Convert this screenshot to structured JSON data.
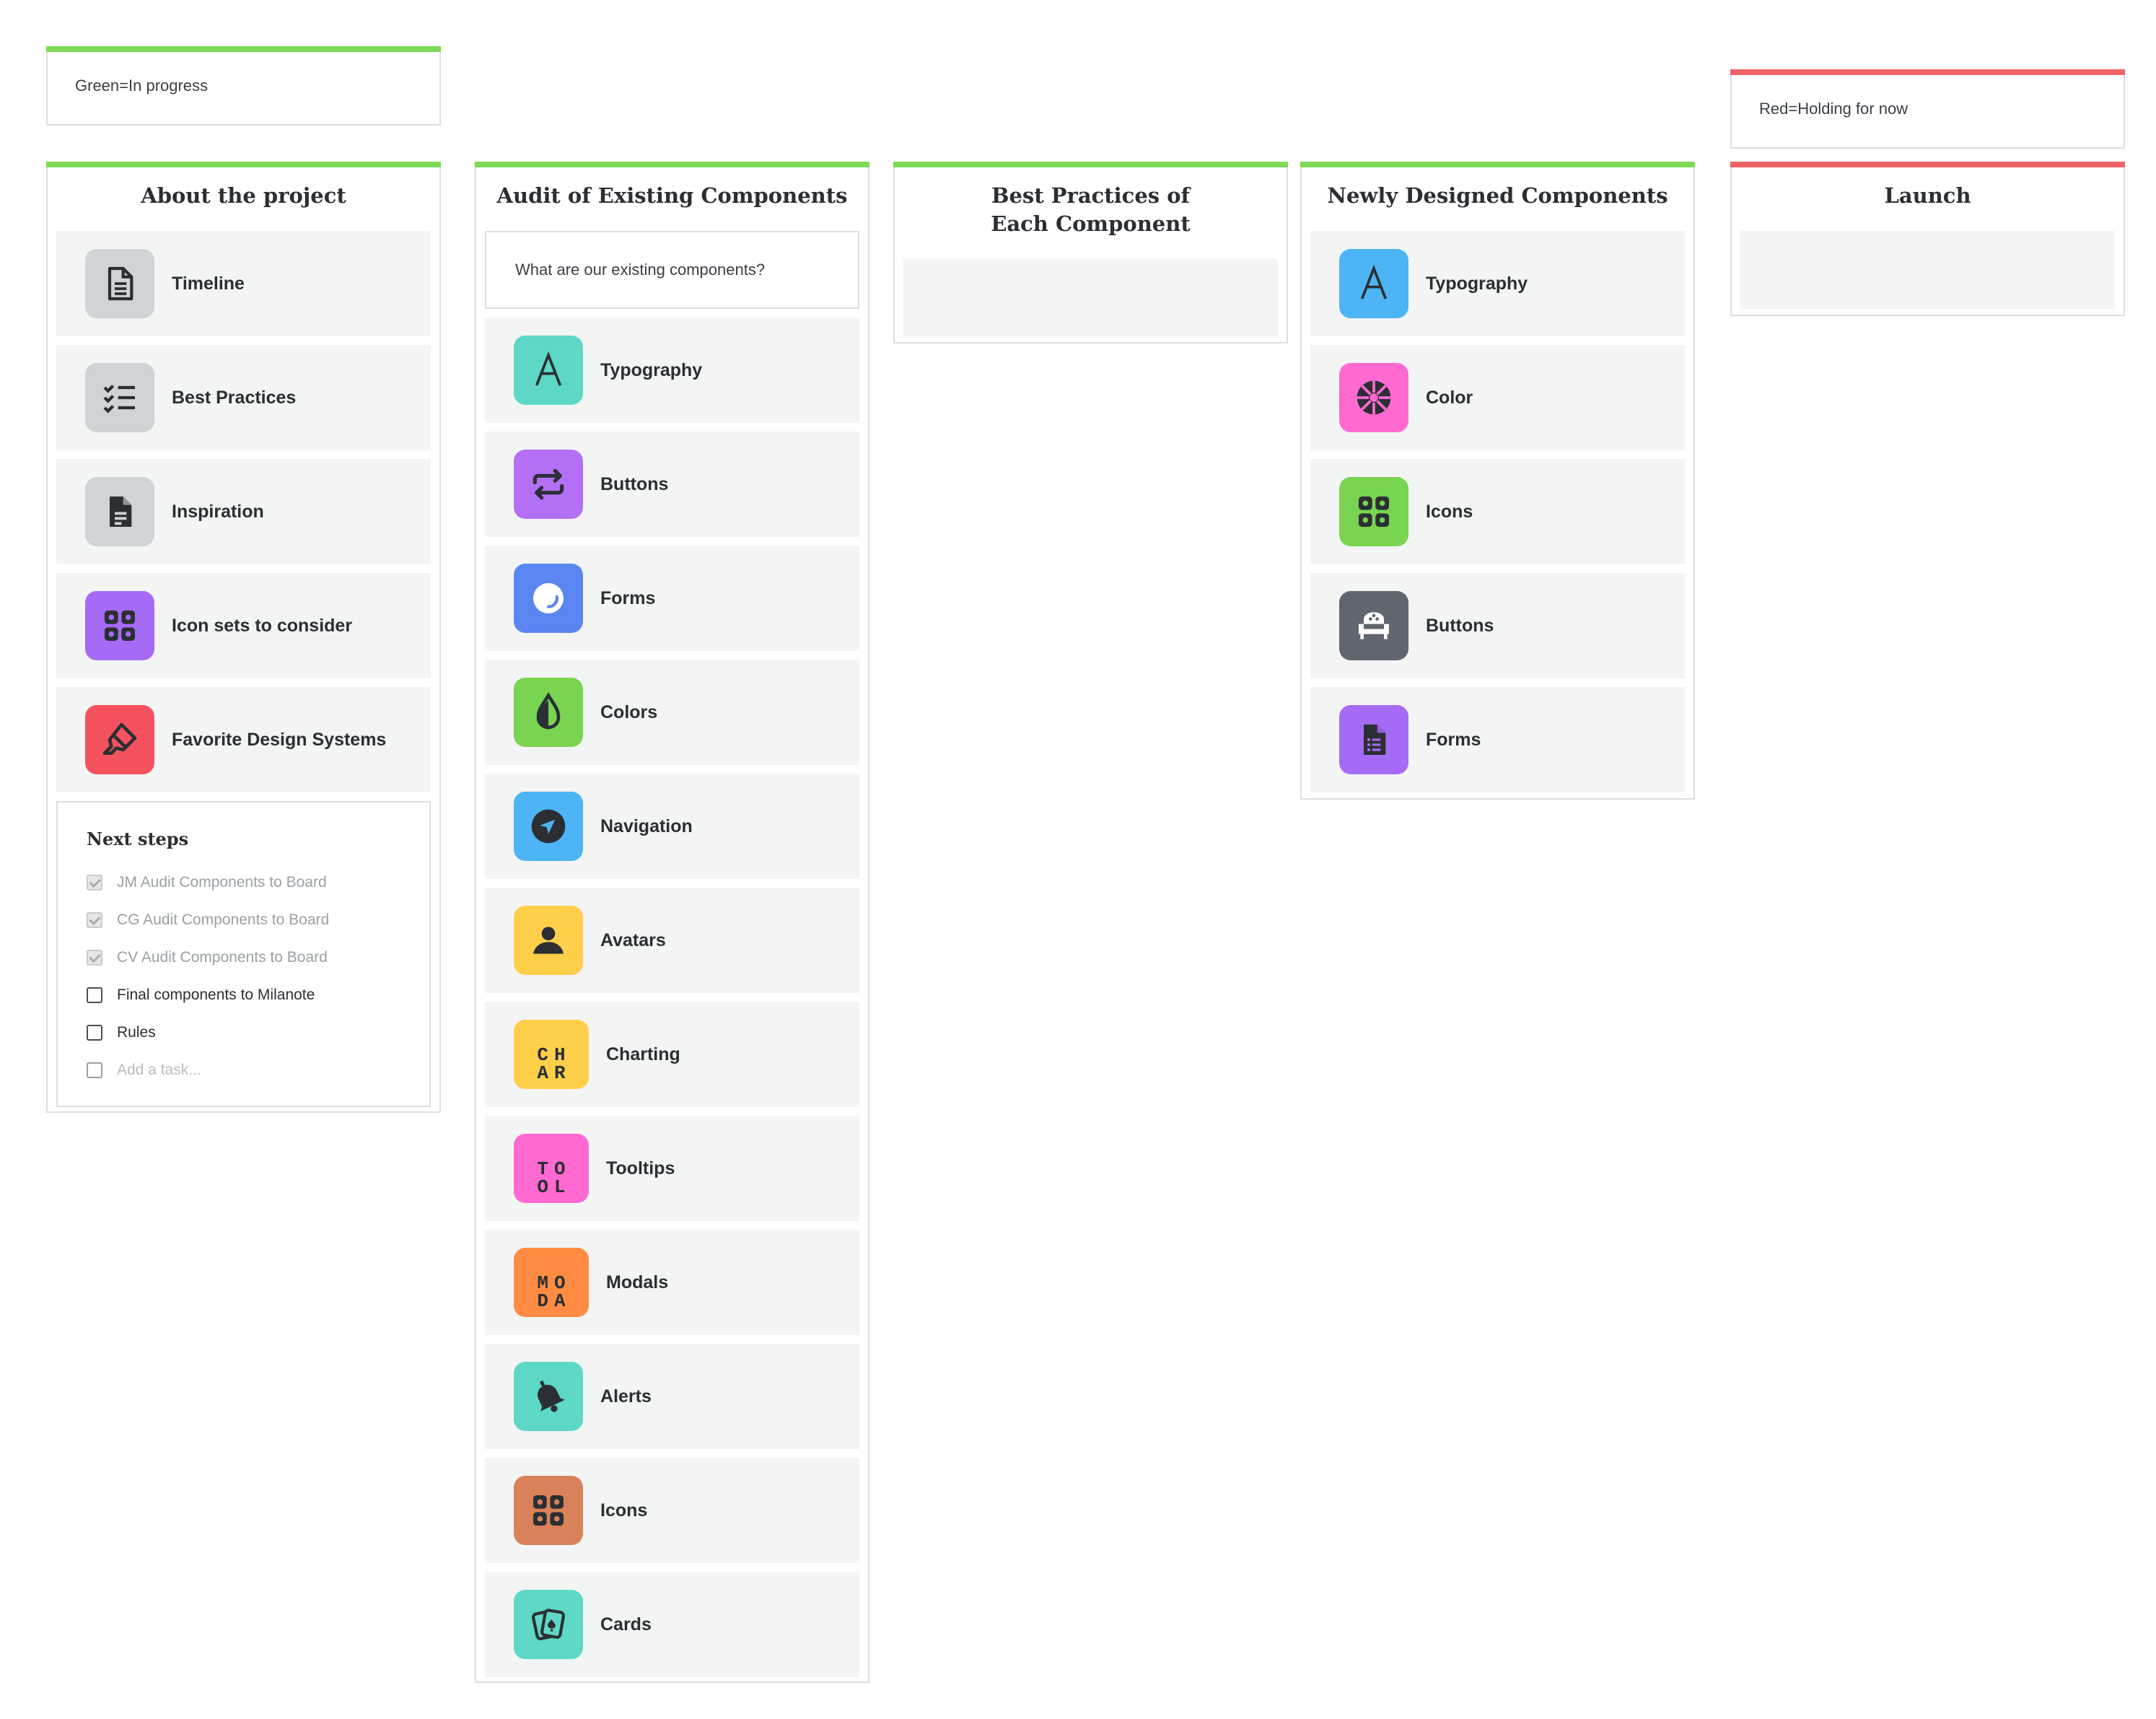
{
  "legend": {
    "green_note": "Green=In progress",
    "red_note": "Red=Holding for now"
  },
  "colors": {
    "green": "#7ed957",
    "red": "#f06467"
  },
  "columns": {
    "about": {
      "title": "About the project",
      "items": [
        {
          "label": "Timeline",
          "icon": "document-icon",
          "color": "#d1d4d6"
        },
        {
          "label": "Best Practices",
          "icon": "checklist-icon",
          "color": "#d1d4d6"
        },
        {
          "label": "Inspiration",
          "icon": "note-icon",
          "color": "#d1d4d6"
        },
        {
          "label": "Icon sets to consider",
          "icon": "grid-icon",
          "color": "#a66bf5"
        },
        {
          "label": "Favorite Design Systems",
          "icon": "highlighter-icon",
          "color": "#f55260"
        }
      ],
      "tasks": {
        "title": "Next steps",
        "items": [
          {
            "label": "JM Audit Components to Board",
            "done": true
          },
          {
            "label": "CG Audit Components to Board",
            "done": true
          },
          {
            "label": "CV Audit Components to Board",
            "done": true
          },
          {
            "label": "Final components to Milanote",
            "done": false
          },
          {
            "label": "Rules",
            "done": false
          }
        ],
        "add_placeholder": "Add a task..."
      }
    },
    "audit": {
      "title": "Audit of Existing Components",
      "question": "What are our existing components?",
      "items": [
        {
          "label": "Typography",
          "icon": "letter-a-icon",
          "color": "#5ed8c6"
        },
        {
          "label": "Buttons",
          "icon": "repeat-icon",
          "color": "#b36ff6"
        },
        {
          "label": "Forms",
          "icon": "circle-icon",
          "color": "#5b86f2"
        },
        {
          "label": "Colors",
          "icon": "drop-icon",
          "color": "#78d451"
        },
        {
          "label": "Navigation",
          "icon": "navigation-icon",
          "color": "#4db5f5"
        },
        {
          "label": "Avatars",
          "icon": "person-icon",
          "color": "#ffcf4a"
        },
        {
          "label": "Charting",
          "icon": "letters-icon",
          "color": "#ffcf4a",
          "letters": [
            "CH",
            "AR"
          ]
        },
        {
          "label": "Tooltips",
          "icon": "letters-icon",
          "color": "#ff6ad1",
          "letters": [
            "TO",
            "OL"
          ]
        },
        {
          "label": "Modals",
          "icon": "letters-icon",
          "color": "#ff8c42",
          "letters": [
            "MO",
            "DA"
          ]
        },
        {
          "label": "Alerts",
          "icon": "bell-icon",
          "color": "#5ed8c6"
        },
        {
          "label": "Icons",
          "icon": "grid-icon",
          "color": "#d9825a"
        },
        {
          "label": "Cards",
          "icon": "playing-cards-icon",
          "color": "#5ed8c6"
        }
      ]
    },
    "best": {
      "title_line1": "Best Practices of",
      "title_line2": "Each Component"
    },
    "newly": {
      "title": "Newly Designed Components",
      "items": [
        {
          "label": "Typography",
          "icon": "letter-a-icon",
          "color": "#4db5f5"
        },
        {
          "label": "Color",
          "icon": "aperture-icon",
          "color": "#ff6ad1"
        },
        {
          "label": "Icons",
          "icon": "grid-icon",
          "color": "#78d451"
        },
        {
          "label": "Buttons",
          "icon": "sofa-icon",
          "color": "#5f6670"
        },
        {
          "label": "Forms",
          "icon": "form-icon",
          "color": "#a66bf5"
        }
      ]
    },
    "launch": {
      "title": "Launch"
    }
  }
}
